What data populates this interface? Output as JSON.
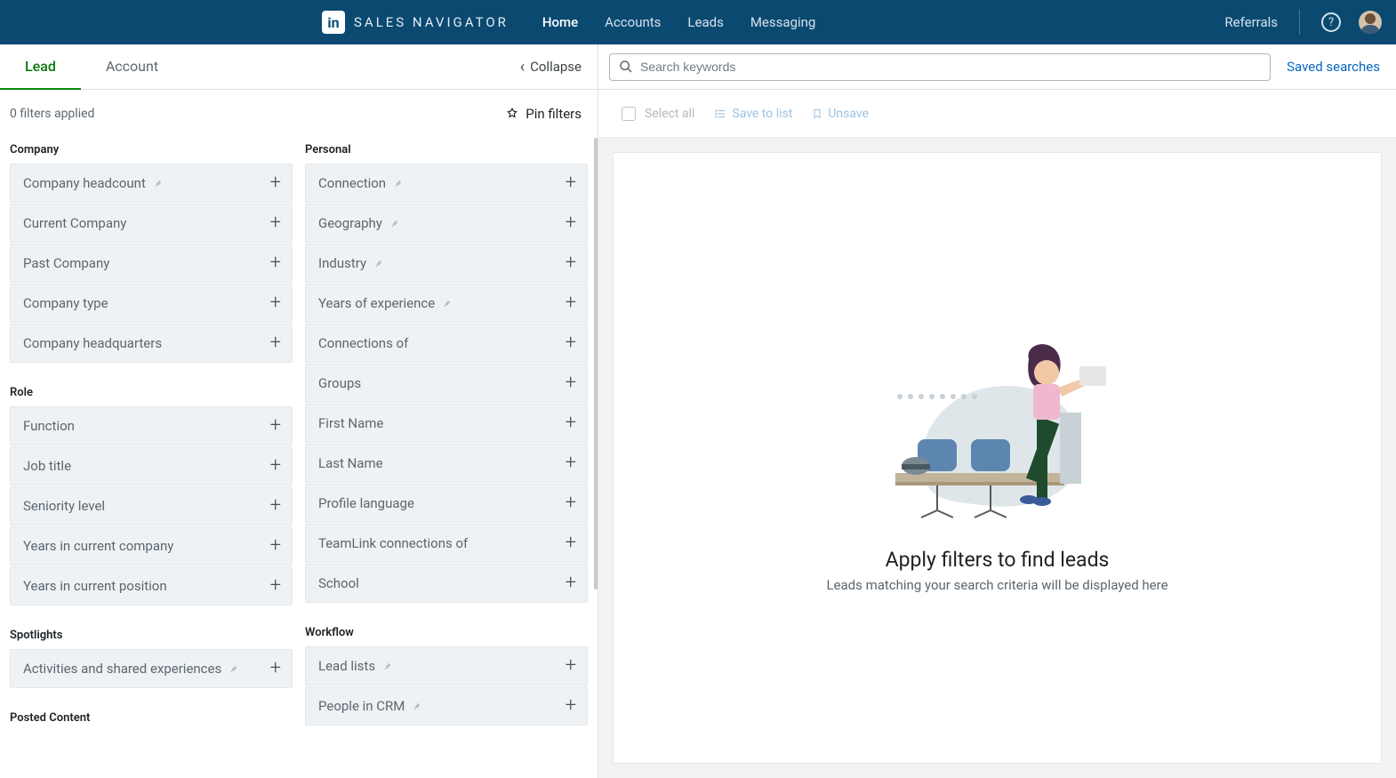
{
  "brand": {
    "logo": "in",
    "text": "SALES NAVIGATOR"
  },
  "nav": {
    "links": [
      "Home",
      "Accounts",
      "Leads",
      "Messaging"
    ],
    "referrals": "Referrals"
  },
  "tabs": {
    "lead": "Lead",
    "account": "Account"
  },
  "collapse_label": "Collapse",
  "filter_status": "0 filters applied",
  "pin_filters_label": "Pin filters",
  "sections": {
    "company": {
      "title": "Company",
      "items": [
        {
          "label": "Company headcount",
          "pinned": true
        },
        {
          "label": "Current Company",
          "pinned": false
        },
        {
          "label": "Past Company",
          "pinned": false
        },
        {
          "label": "Company type",
          "pinned": false
        },
        {
          "label": "Company headquarters",
          "pinned": false
        }
      ]
    },
    "role": {
      "title": "Role",
      "items": [
        {
          "label": "Function",
          "pinned": false
        },
        {
          "label": "Job title",
          "pinned": false
        },
        {
          "label": "Seniority level",
          "pinned": false
        },
        {
          "label": "Years in current company",
          "pinned": false
        },
        {
          "label": "Years in current position",
          "pinned": false
        }
      ]
    },
    "spotlights": {
      "title": "Spotlights",
      "items": [
        {
          "label": "Activities and shared experiences",
          "pinned": true
        }
      ]
    },
    "posted": {
      "title": "Posted Content"
    },
    "personal": {
      "title": "Personal",
      "items": [
        {
          "label": "Connection",
          "pinned": true
        },
        {
          "label": "Geography",
          "pinned": true
        },
        {
          "label": "Industry",
          "pinned": true
        },
        {
          "label": "Years of experience",
          "pinned": true
        },
        {
          "label": "Connections of",
          "pinned": false
        },
        {
          "label": "Groups",
          "pinned": false
        },
        {
          "label": "First Name",
          "pinned": false
        },
        {
          "label": "Last Name",
          "pinned": false
        },
        {
          "label": "Profile language",
          "pinned": false
        },
        {
          "label": "TeamLink connections of",
          "pinned": false
        },
        {
          "label": "School",
          "pinned": false
        }
      ]
    },
    "workflow": {
      "title": "Workflow",
      "items": [
        {
          "label": "Lead lists",
          "pinned": true
        },
        {
          "label": "People in CRM",
          "pinned": true
        }
      ]
    }
  },
  "search": {
    "placeholder": "Search keywords",
    "saved_label": "Saved searches"
  },
  "actions": {
    "select_all": "Select all",
    "save_to_list": "Save to list",
    "unsave": "Unsave"
  },
  "empty_state": {
    "title": "Apply filters to find leads",
    "subtitle": "Leads matching your search criteria will be displayed here"
  }
}
